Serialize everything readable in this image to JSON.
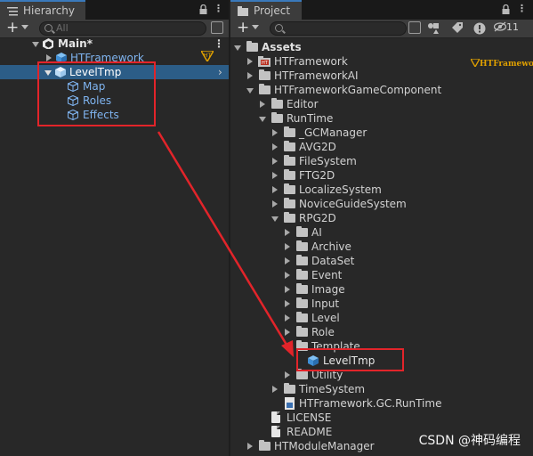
{
  "hierarchy": {
    "tab_title": "Hierarchy",
    "search_placeholder": "All",
    "scene": "Main*",
    "items": [
      {
        "label": "HTFramework"
      },
      {
        "label": "LevelTmp"
      },
      {
        "label": "Map"
      },
      {
        "label": "Roles"
      },
      {
        "label": "Effects"
      }
    ]
  },
  "project": {
    "tab_title": "Project",
    "hidden_count": "11",
    "logo_text": "HTFramework",
    "tree": [
      {
        "label": "Assets"
      },
      {
        "label": "HTFramework"
      },
      {
        "label": "HTFrameworkAI"
      },
      {
        "label": "HTFrameworkGameComponent"
      },
      {
        "label": "Editor"
      },
      {
        "label": "RunTime"
      },
      {
        "label": "_GCManager"
      },
      {
        "label": "AVG2D"
      },
      {
        "label": "FileSystem"
      },
      {
        "label": "FTG2D"
      },
      {
        "label": "LocalizeSystem"
      },
      {
        "label": "NoviceGuideSystem"
      },
      {
        "label": "RPG2D"
      },
      {
        "label": "AI"
      },
      {
        "label": "Archive"
      },
      {
        "label": "DataSet"
      },
      {
        "label": "Event"
      },
      {
        "label": "Image"
      },
      {
        "label": "Input"
      },
      {
        "label": "Level"
      },
      {
        "label": "Role"
      },
      {
        "label": "Template"
      },
      {
        "label": "LevelTmp"
      },
      {
        "label": "Utility"
      },
      {
        "label": "TimeSystem"
      },
      {
        "label": "HTFramework.GC.RunTime"
      },
      {
        "label": "LICENSE"
      },
      {
        "label": "README"
      },
      {
        "label": "HTModuleManager"
      }
    ]
  },
  "watermark": "CSDN @神码编程",
  "colors": {
    "selection": "#2c5d87",
    "highlight_box": "#e2242a",
    "link_blue": "#7fb4f0",
    "prefab_blue": "#59a8e8"
  }
}
